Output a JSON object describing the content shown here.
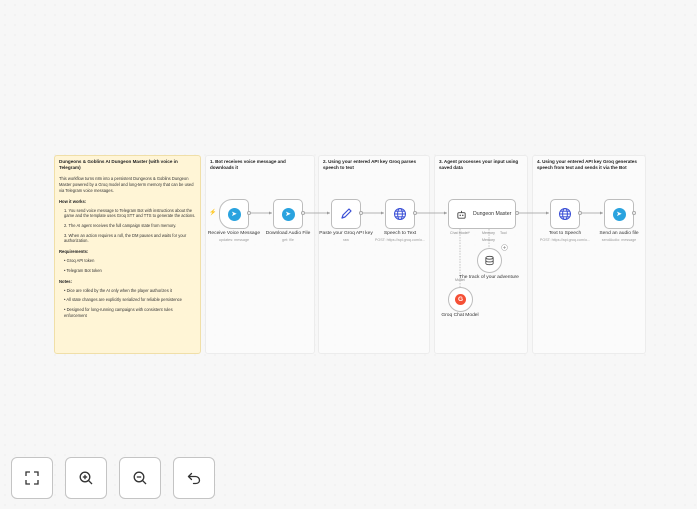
{
  "sticky_intro": {
    "title": "Dungeons & Goblins AI Dungeon Master (with voice in Telegram)",
    "description": "This workflow turns n8n into a persistent Dungeons & Goblins Dungeon Master powered by a Groq model and long-term memory that can be used via Telegram voice messages.",
    "how_heading": "How it works:",
    "how_steps": [
      "1. You send voice message to Telegram Bot with instructions about the game and the template uses Groq STT and TTS to generate the actions.",
      "2. The AI agent receives the full campaign state from memory.",
      "3. When an action requires a roll, the DM pauses and waits for your authorization."
    ],
    "req_heading": "Requirements:",
    "requirements": [
      "Groq API token",
      "Telegram Bot token"
    ],
    "notes_heading": "Notes:",
    "notes": [
      "Dice are rolled by the AI only when the player authorizes it",
      "All state changes are explicitly serialized for reliable persistence",
      "Designed for long-running campaigns with consistent rules enforcement"
    ]
  },
  "sticky_steps": [
    "1. Bot receives voice message and downloads it",
    "2. Using your entered API key Groq parses speech to text",
    "3. Agent processes your input using saved data",
    "4. Using your entered API key Groq generates speech from text and sends it via the Bot"
  ],
  "nodes": {
    "receive": {
      "label": "Receive Voice Message",
      "sub": "updates: message",
      "icon": "telegram-icon"
    },
    "download": {
      "label": "Download Audio File",
      "sub": "get: file",
      "icon": "telegram-icon"
    },
    "paste_key": {
      "label": "Paste your Groq API key",
      "sub": "raw",
      "icon": "pencil-icon"
    },
    "stt": {
      "label": "Speech to Text",
      "sub": "POST: https://api.groq.com/o...",
      "icon": "globe-icon"
    },
    "dm": {
      "label": "Dungeon Master",
      "sub_chat": "Chat Model*",
      "sub_memory": "Memory",
      "sub_tool": "Tool",
      "icon": "robot-icon"
    },
    "memory": {
      "label": "The track of your adventure",
      "icon": "database-icon"
    },
    "groq": {
      "label": "Groq Chat Model",
      "icon": "groq-icon"
    },
    "tts": {
      "label": "Text to Speech",
      "sub": "POST: https://api.groq.com/o...",
      "icon": "globe-icon"
    },
    "send": {
      "label": "Send an audio file",
      "sub": "sendAudio: message",
      "icon": "telegram-icon"
    }
  },
  "edge_labels": {
    "model": "Model",
    "memory": "Memory"
  },
  "controls": [
    {
      "name": "fit-view-button",
      "icon": "fit-view-icon"
    },
    {
      "name": "zoom-in-button",
      "icon": "zoom-in-icon"
    },
    {
      "name": "zoom-out-button",
      "icon": "zoom-out-icon"
    },
    {
      "name": "undo-button",
      "icon": "undo-icon"
    }
  ],
  "colors": {
    "accent": "#ff6d5a",
    "telegram": "#2aa3df",
    "globe": "#3a4fd6",
    "groq": "#f55036",
    "sticky_intro": "#fff5d6"
  }
}
